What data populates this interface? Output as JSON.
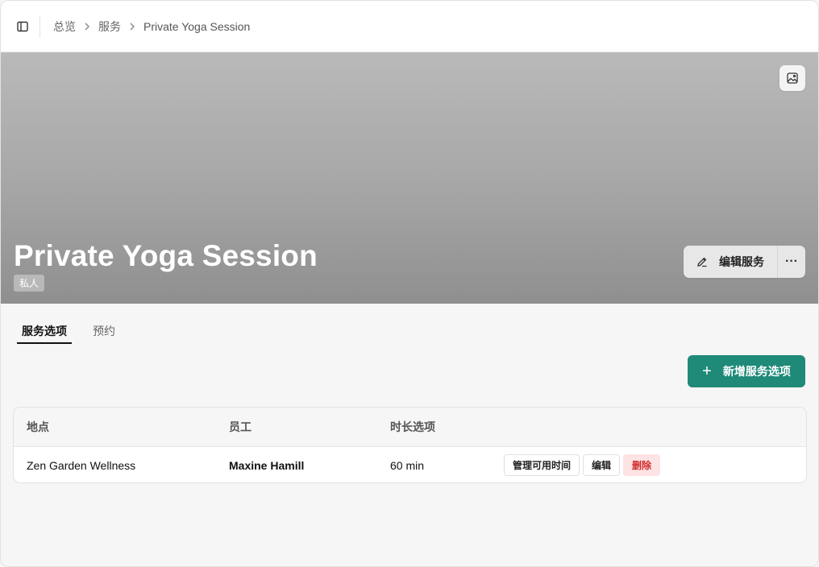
{
  "breadcrumb": {
    "items": [
      "总览",
      "服务",
      "Private Yoga Session"
    ]
  },
  "service": {
    "title": "Private Yoga Session",
    "privacy_badge": "私人",
    "edit_label": "编辑服务",
    "more_label": "···"
  },
  "tabs": [
    {
      "label": "服务选项",
      "active": true
    },
    {
      "label": "预约",
      "active": false
    }
  ],
  "add_button": {
    "label": "新增服务选项",
    "color": "#1f8a78"
  },
  "table": {
    "headers": [
      "地点",
      "员工",
      "时长选项"
    ],
    "rows": [
      {
        "location": "Zen Garden Wellness",
        "staff": "Maxine Hamill",
        "duration": "60 min",
        "actions": [
          "管理可用时间",
          "编辑",
          "删除"
        ]
      }
    ]
  },
  "colors": {
    "danger": "#d12a2a",
    "danger_bg": "#fde3e3"
  }
}
